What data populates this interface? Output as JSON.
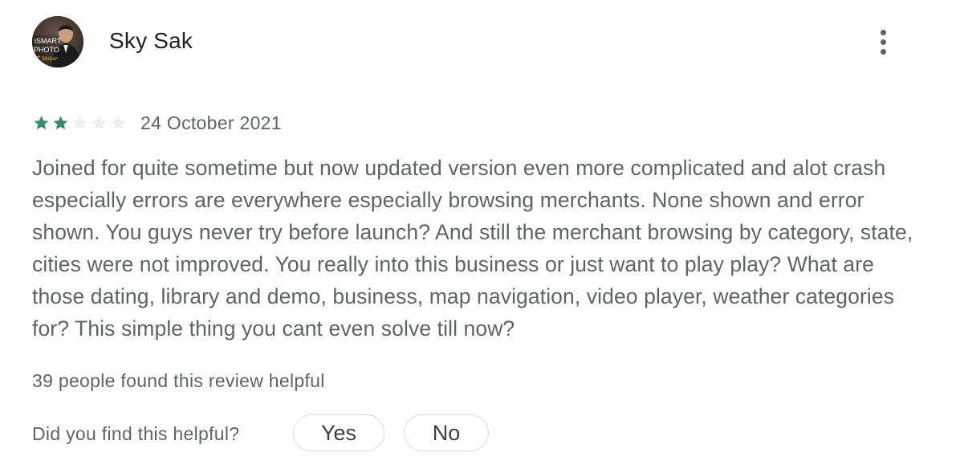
{
  "review": {
    "author": "Sky Sak",
    "avatar_text": {
      "line1": "iSMART",
      "line2": "PHOTO",
      "line3": "Maker"
    },
    "rating": 2,
    "rating_max": 5,
    "date": "24 October 2021",
    "text": "Joined for quite sometime but now updated version even more complicated and alot crash especially errors are everywhere especially browsing merchants. None shown and error shown. You guys never try before launch? And still the merchant browsing by category, state, cities were not improved. You really into this business or just want to play play? What are those dating, library and demo, business, map navigation, video player, weather categories for? This simple thing you cant even solve till now?",
    "helpful_count_text": "39 people found this review helpful",
    "helpful_question": "Did you find this helpful?",
    "yes_label": "Yes",
    "no_label": "No"
  },
  "icons": {
    "more": "more-vert-icon",
    "star": "star-icon"
  },
  "colors": {
    "star_filled": "#3c8c6c",
    "star_empty": "#eceef0",
    "author": "#202124",
    "text": "#5f6368",
    "button_border": "#dadce0"
  }
}
